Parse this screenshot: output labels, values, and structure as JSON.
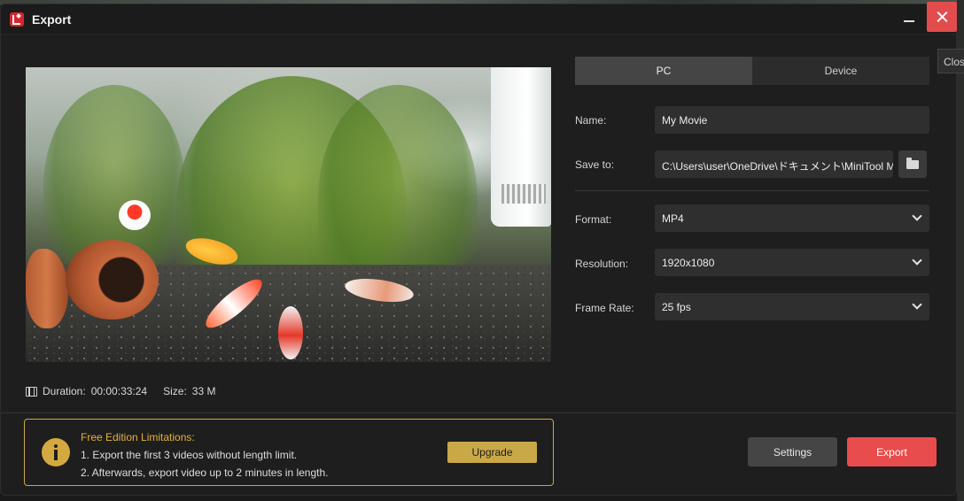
{
  "window": {
    "title": "Export",
    "close_tooltip": "Close"
  },
  "preview": {
    "duration_label": "Duration:",
    "duration_value": "00:00:33:24",
    "size_label": "Size:",
    "size_value": "33 M"
  },
  "tabs": [
    {
      "label": "PC",
      "active": true
    },
    {
      "label": "Device",
      "active": false
    }
  ],
  "form": {
    "name_label": "Name:",
    "name_value": "My Movie",
    "save_label": "Save to:",
    "save_value": "C:\\Users\\user\\OneDrive\\ドキュメント\\MiniTool Mov",
    "format_label": "Format:",
    "format_value": "MP4",
    "resolution_label": "Resolution:",
    "resolution_value": "1920x1080",
    "framerate_label": "Frame Rate:",
    "framerate_value": "25 fps"
  },
  "limitations": {
    "title": "Free Edition Limitations:",
    "line1": "1. Export the first 3 videos without length limit.",
    "line2": "2. Afterwards, export video up to 2 minutes in length.",
    "upgrade_label": "Upgrade"
  },
  "buttons": {
    "settings": "Settings",
    "export": "Export"
  },
  "colors": {
    "accent_red": "#e84c4c",
    "gold": "#c9a848"
  }
}
